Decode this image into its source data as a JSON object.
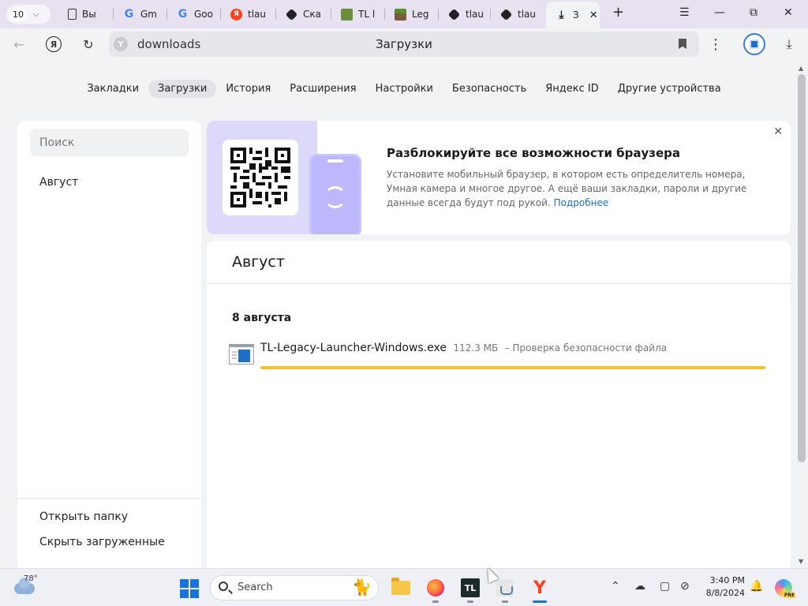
{
  "tabstrip": {
    "tab_count": "10",
    "tabs": [
      {
        "label": "Вы",
        "icon": "document-icon"
      },
      {
        "label": "Gm",
        "icon": "google-icon"
      },
      {
        "label": "Goo",
        "icon": "google-icon"
      },
      {
        "label": "tlau",
        "icon": "yandex-icon"
      },
      {
        "label": "Ска",
        "icon": "cube-icon"
      },
      {
        "label": "TL l",
        "icon": "minecraft-icon"
      },
      {
        "label": "Leg",
        "icon": "grass-block-icon"
      },
      {
        "label": "tlau",
        "icon": "cube-icon"
      },
      {
        "label": "tlau",
        "icon": "cube-icon"
      },
      {
        "label": "З",
        "icon": "download-icon",
        "active": true
      }
    ]
  },
  "navbar": {
    "url": "downloads",
    "page_title": "Загрузки"
  },
  "page_tabs": [
    "Закладки",
    "Загрузки",
    "История",
    "Расширения",
    "Настройки",
    "Безопасность",
    "Яндекс ID",
    "Другие устройства"
  ],
  "active_page_tab": "Загрузки",
  "sidebar": {
    "search_placeholder": "Поиск",
    "month": "Август",
    "open_folder": "Открыть папку",
    "hide_downloaded": "Скрыть загруженные"
  },
  "promo": {
    "title": "Разблокируйте все возможности браузера",
    "text": "Установите мобильный браузер, в котором есть определитель номера, Умная камера и многое другое. А ещё ваши закладки, пароли и другие данные всегда будут под рукой.",
    "link": "Подробнее"
  },
  "downloads": {
    "month": "Август",
    "date": "8 августа",
    "items": [
      {
        "name": "TL-Legacy-Launcher-Windows.exe",
        "size": "112.3 МБ",
        "status": "– Проверка безопасности файла",
        "progress": 1.0,
        "progress_color": "#f1c232"
      }
    ]
  },
  "taskbar": {
    "temperature": "78°",
    "search_label": "Search",
    "time": "3:40 PM",
    "date": "8/8/2024"
  },
  "colors": {
    "accent": "#1a6ec9",
    "tabstrip_bg": "#e8e2f0",
    "page_bg": "#f2f3f5",
    "promo_art": "#dcd9fb"
  }
}
